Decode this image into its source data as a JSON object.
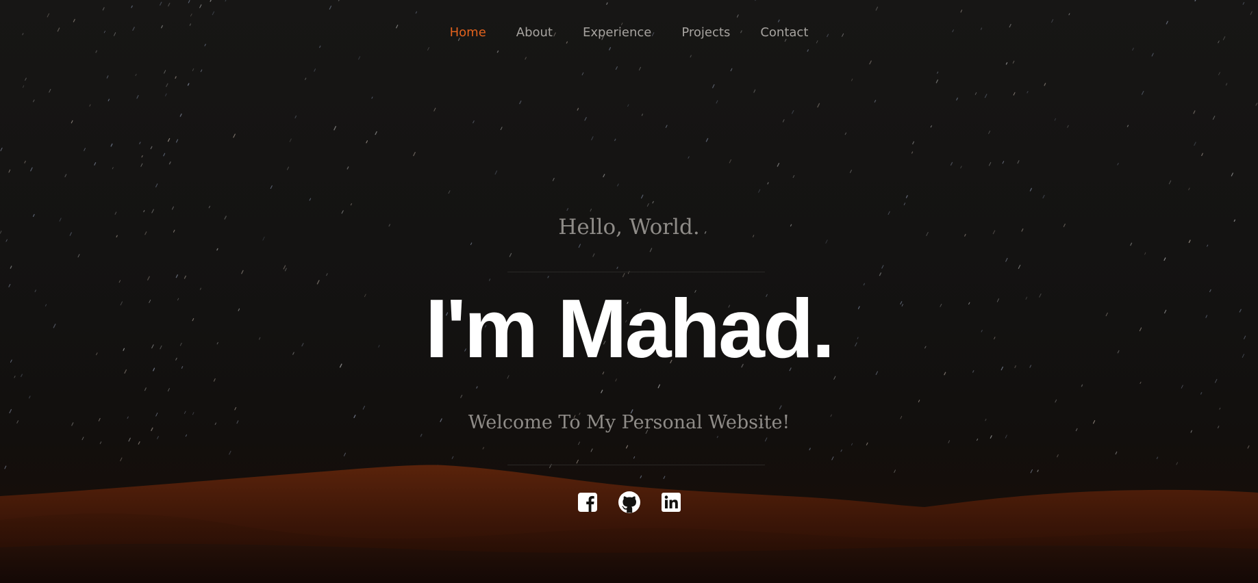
{
  "nav": {
    "items": [
      {
        "label": "Home",
        "active": true
      },
      {
        "label": "About",
        "active": false
      },
      {
        "label": "Experience",
        "active": false
      },
      {
        "label": "Projects",
        "active": false
      },
      {
        "label": "Contact",
        "active": false
      }
    ]
  },
  "hero": {
    "greeting": "Hello, World.",
    "name": "I'm Mahad.",
    "tagline": "Welcome To My Personal Website!"
  },
  "socials": [
    {
      "icon": "facebook-icon"
    },
    {
      "icon": "github-icon"
    },
    {
      "icon": "linkedin-icon"
    }
  ],
  "colors": {
    "accent": "#e2621d",
    "background": "#131210",
    "nav_text": "#a7a4a0",
    "muted_text": "#8f8c88",
    "heading": "#ffffff",
    "dune": "#4a1d0a"
  }
}
